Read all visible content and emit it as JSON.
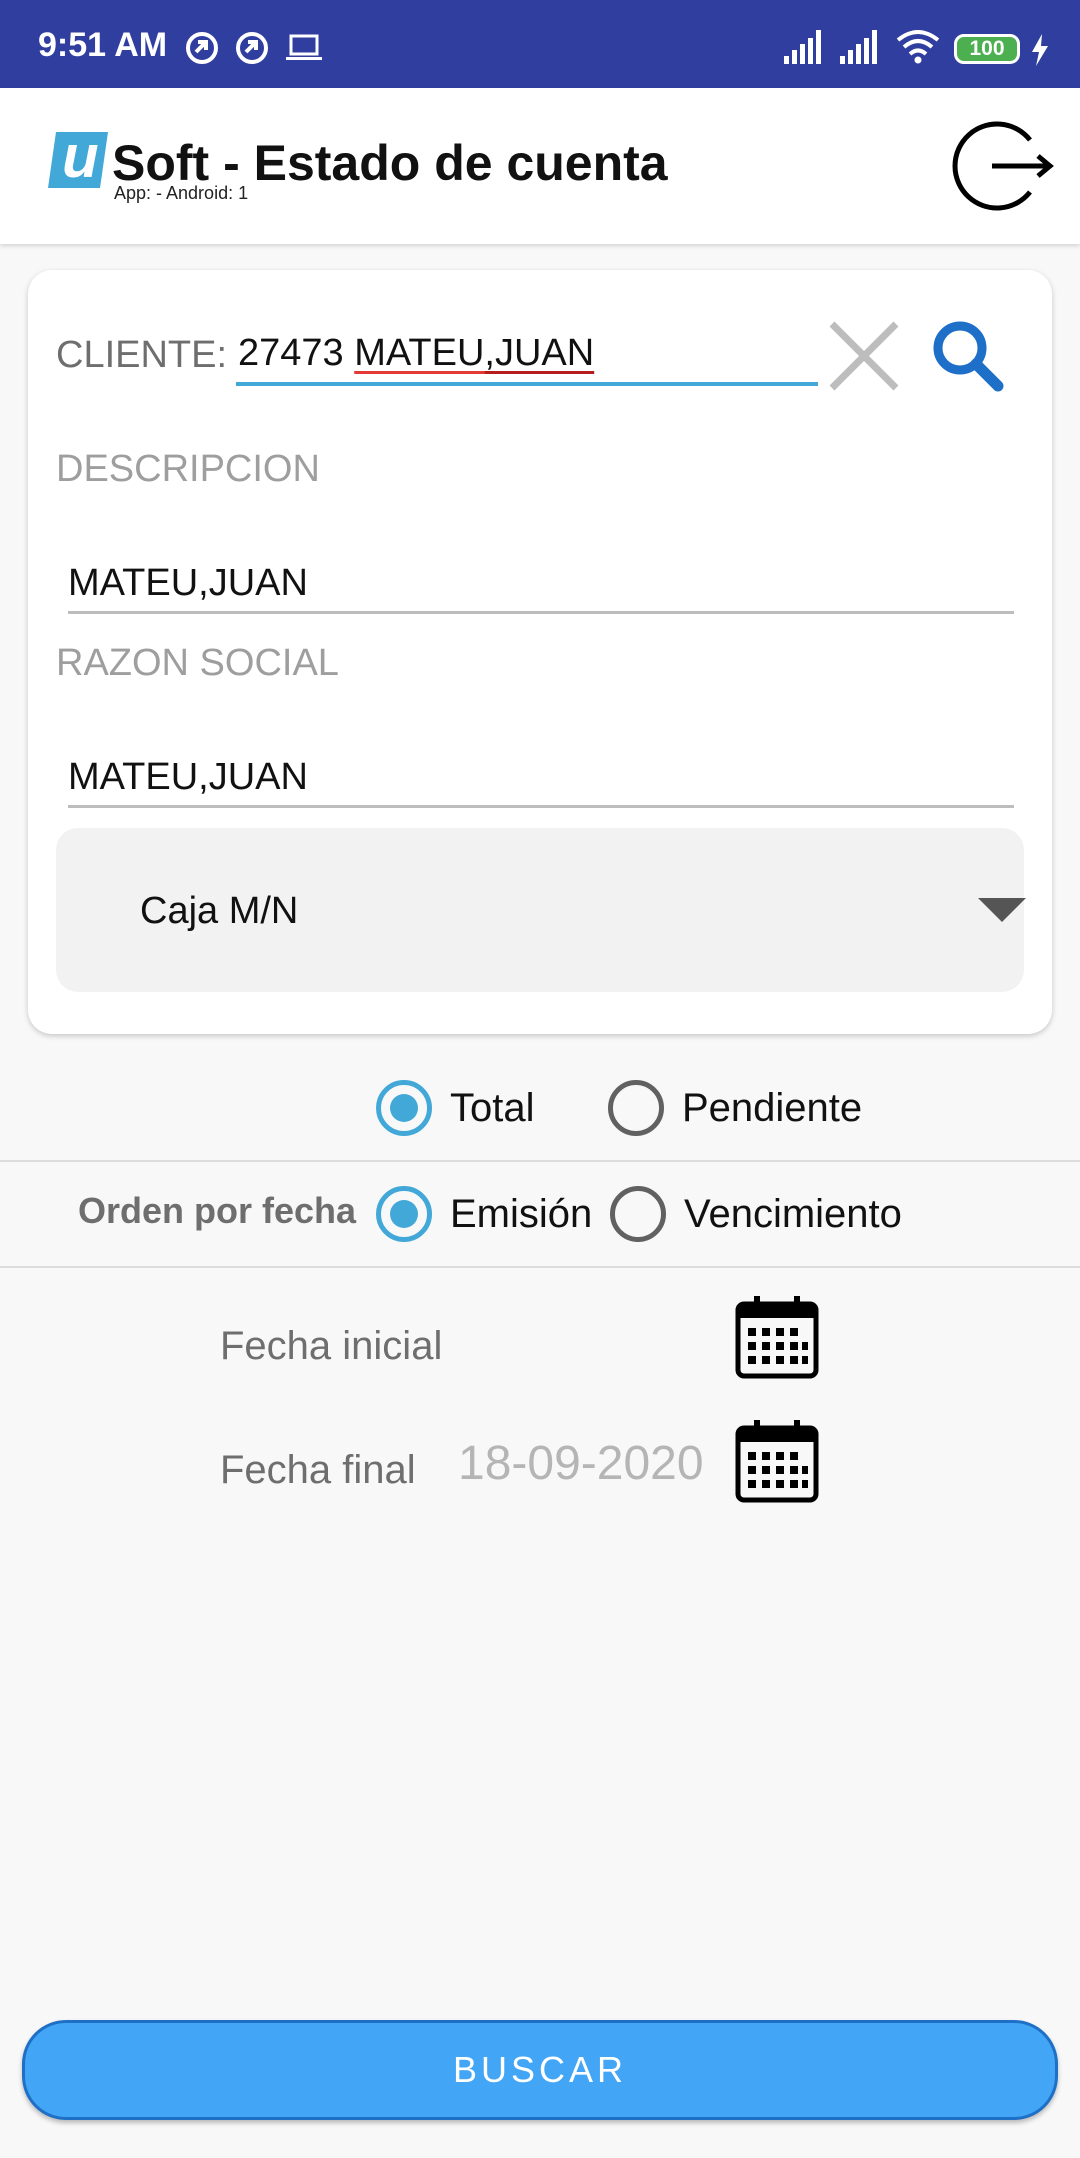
{
  "status_bar": {
    "time": "9:51 AM",
    "battery": "100"
  },
  "app_bar": {
    "title": "Soft - Estado de cuenta",
    "subtitle": "App:  - Android: 1",
    "logo_letter": "u"
  },
  "form": {
    "cliente_label": "CLIENTE:",
    "cliente_number": "27473",
    "cliente_name_part1": "MATEU",
    "cliente_name_part2": "JUAN",
    "descripcion_label": "DESCRIPCION",
    "descripcion_value": "MATEU,JUAN",
    "razon_label": "RAZON SOCIAL",
    "razon_value": "MATEU,JUAN",
    "caja_selected": "Caja M/N"
  },
  "tipo": {
    "options": [
      "Total",
      "Pendiente"
    ],
    "selected": "Total"
  },
  "orden": {
    "label": "Orden por fecha",
    "options": [
      "Emisión",
      "Vencimiento"
    ],
    "selected": "Emisión"
  },
  "fechas": {
    "inicial_label": "Fecha inicial",
    "inicial_value": "",
    "final_label": "Fecha final",
    "final_value": "18-09-2020"
  },
  "buscar_label": "BUSCAR",
  "colors": {
    "status_bar": "#303f9f",
    "accent": "#42a8d8",
    "button": "#42a5f5",
    "search_icon": "#1e6fc7"
  }
}
